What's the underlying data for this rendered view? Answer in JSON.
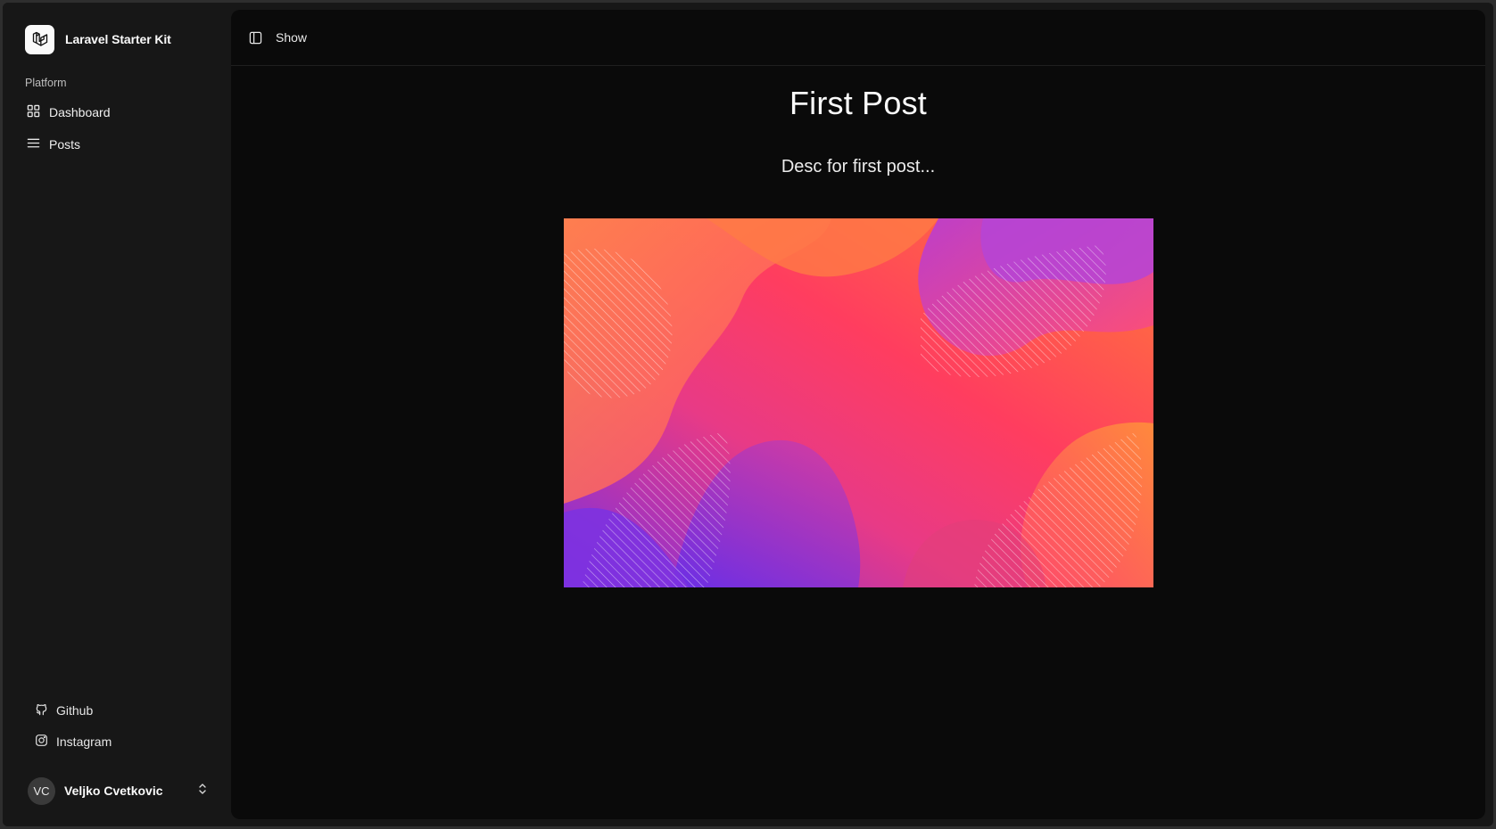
{
  "app": {
    "name": "Laravel Starter Kit",
    "logo_icon": "laravel-logo-icon"
  },
  "sidebar": {
    "group_label": "Platform",
    "items": [
      {
        "label": "Dashboard",
        "icon": "grid-icon"
      },
      {
        "label": "Posts",
        "icon": "list-icon"
      }
    ],
    "footer_items": [
      {
        "label": "Github",
        "icon": "github-icon"
      },
      {
        "label": "Instagram",
        "icon": "instagram-icon"
      }
    ],
    "user": {
      "initials": "VC",
      "name": "Veljko Cvetkovic",
      "icon": "chevrons-up-down-icon"
    }
  },
  "header": {
    "toggle_icon": "sidebar-toggle-icon",
    "breadcrumb": "Show"
  },
  "post": {
    "title": "First Post",
    "description": "Desc for first post..."
  },
  "colors": {
    "page_bg": "#0a0a0a",
    "sidebar_bg": "#171717",
    "text": "#fafafa"
  }
}
